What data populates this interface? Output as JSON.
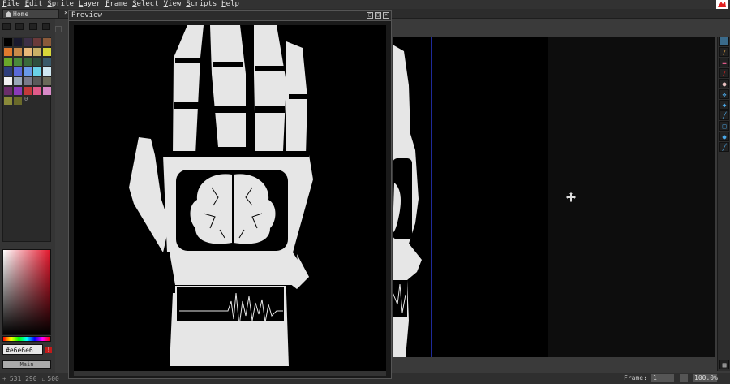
{
  "menubar": {
    "items": [
      {
        "label": "File",
        "u": "F",
        "rest": "ile"
      },
      {
        "label": "Edit",
        "u": "E",
        "rest": "dit"
      },
      {
        "label": "Sprite",
        "u": "S",
        "rest": "prite"
      },
      {
        "label": "Layer",
        "u": "L",
        "rest": "ayer"
      },
      {
        "label": "Frame",
        "u": "F",
        "rest": "rame"
      },
      {
        "label": "Select",
        "u": "S",
        "rest": "elect"
      },
      {
        "label": "View",
        "u": "V",
        "rest": "iew"
      },
      {
        "label": "Scripts",
        "u": "S",
        "rest": "cripts"
      },
      {
        "label": "Help",
        "u": "H",
        "rest": "elp"
      }
    ]
  },
  "tabs": {
    "home_label": "Home",
    "close_glyph": "×"
  },
  "preview": {
    "title": "Preview",
    "btn_a": "□",
    "btn_b": "□",
    "btn_close": "×"
  },
  "palette": {
    "colors": [
      "#000000",
      "#1a1a2e",
      "#3d3047",
      "#6b3a3a",
      "#8a5a3a",
      "#e07a2e",
      "#c98a4a",
      "#e8b87a",
      "#c9b066",
      "#d8d63a",
      "#6aa82a",
      "#4a8a3a",
      "#3a6a3a",
      "#2e4e3e",
      "#3a5a6a",
      "#2e3e7a",
      "#5a6ad8",
      "#6a9ae8",
      "#6ad2e8",
      "#cfe8f2",
      "#f2f2f2",
      "#9aa8b8",
      "#7a7a8a",
      "#5a5a5a",
      "#6a6a5a",
      "#6a2e6a",
      "#8a3ab8",
      "#c23a3a",
      "#e05a8a",
      "#d88ac8",
      "#8a8a3a",
      "#6a6a2a"
    ],
    "index_label": "0"
  },
  "color": {
    "hex": "#e6e6e6",
    "warn": "!",
    "main_label": "Main"
  },
  "status": {
    "coords": "531 290",
    "size": "500",
    "frame_label": "Frame:",
    "frame_value": "1",
    "zoom": "100.0%"
  },
  "colors": {
    "accent": "#e02020",
    "selection_blue": "#1e2a9a",
    "art_white": "#e6e6e6"
  }
}
